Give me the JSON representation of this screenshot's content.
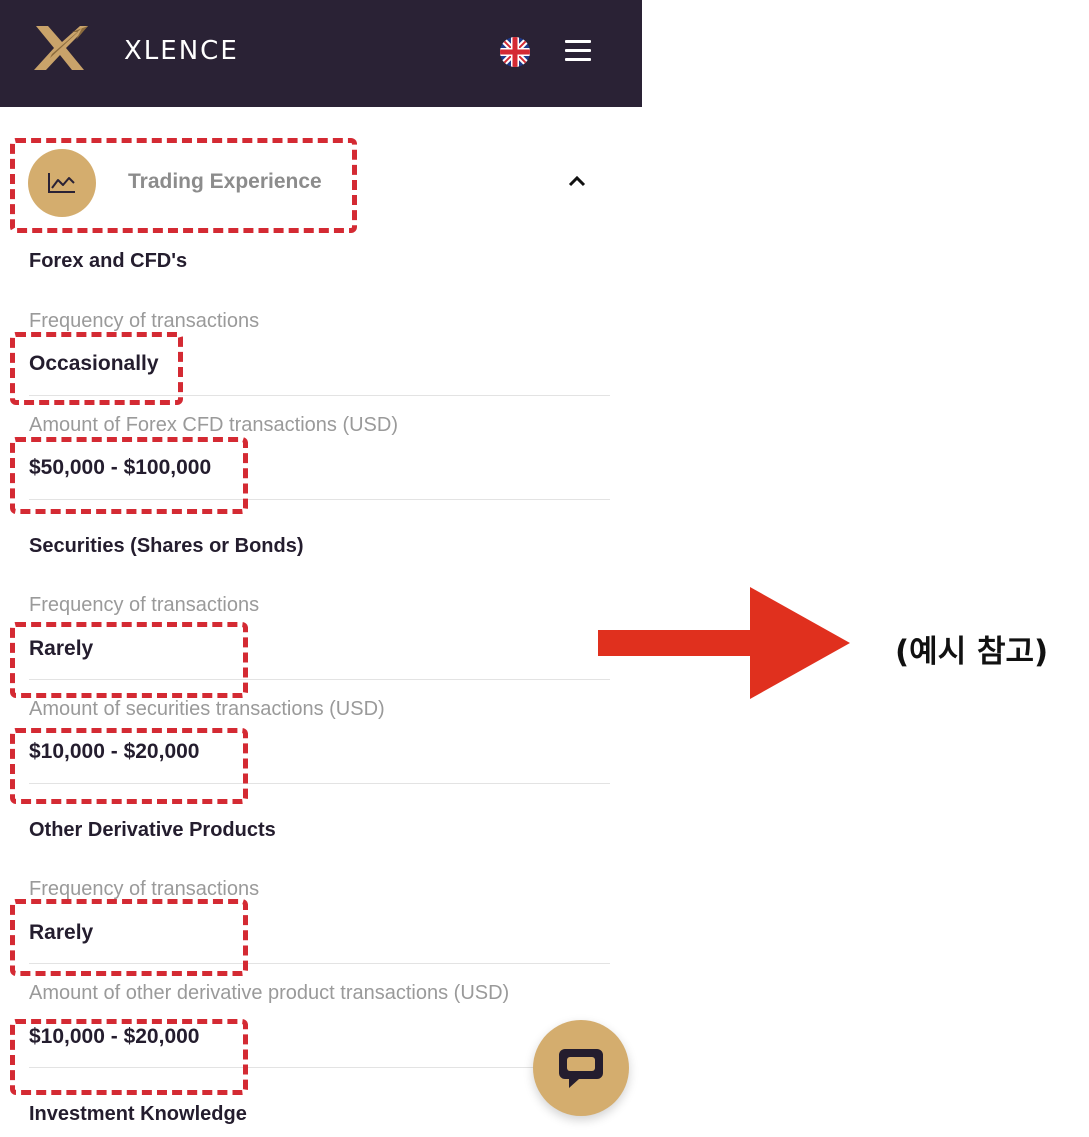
{
  "header": {
    "brand": "XLENCE",
    "logo_icon": "xlence-logo-icon",
    "language_icon": "uk-flag-icon",
    "menu_icon": "hamburger-menu-icon",
    "background_color": "#2a2235"
  },
  "section": {
    "title": "Trading Experience",
    "icon": "line-chart-icon",
    "toggle_icon": "chevron-up-icon",
    "accent_color": "#d4ad6e"
  },
  "groups": [
    {
      "title": "Forex and CFD's",
      "fields": [
        {
          "label": "Frequency of transactions",
          "value": "Occasionally"
        },
        {
          "label": "Amount of Forex CFD transactions (USD)",
          "value": "$50,000 - $100,000"
        }
      ]
    },
    {
      "title": "Securities (Shares or Bonds)",
      "fields": [
        {
          "label": "Frequency of transactions",
          "value": "Rarely"
        },
        {
          "label": "Amount of securities transactions (USD)",
          "value": "$10,000 - $20,000"
        }
      ]
    },
    {
      "title": "Other Derivative Products",
      "fields": [
        {
          "label": "Frequency of transactions",
          "value": "Rarely"
        },
        {
          "label": "Amount of other derivative product transactions (USD)",
          "value": "$10,000 - $20,000"
        }
      ]
    }
  ],
  "next_section_title": "Investment Knowledge",
  "chat": {
    "icon": "chat-bubble-icon"
  },
  "annotation": {
    "note": "(예시 참고)",
    "arrow_icon": "right-arrow-icon",
    "highlight_color": "#d42a33"
  }
}
